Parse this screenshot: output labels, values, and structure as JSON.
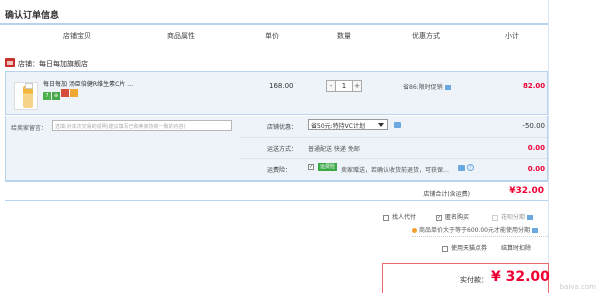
{
  "page": {
    "title": "确认订单信息"
  },
  "columns": [
    "店铺宝贝",
    "商品属性",
    "单价",
    "数量",
    "优惠方式",
    "小计"
  ],
  "shop": {
    "label": "店铺：每日每加旗舰店"
  },
  "item": {
    "name": "每日每加 汤臣倍健R维生素C片 …",
    "price": "168.00",
    "quantity": "1",
    "minus": "-",
    "plus": "+",
    "promo": "省86:限时促销",
    "subtotal": "82.00",
    "badges": [
      "7",
      "⊕",
      "",
      ""
    ]
  },
  "message": {
    "label": "给卖家留言：",
    "placeholder": "选填:对本次交易的说明(建议填写已和卖家协商一致的内容)"
  },
  "options": {
    "discount_label": "店铺优惠：",
    "discount_value": "省50元:特持VC计划",
    "discount_amount": "-50.00",
    "shipping_label": "运送方式：",
    "shipping_value": "普通配送 快递 免邮",
    "shipping_amount": "0.00",
    "insurance_label": "运费险：",
    "insurance_tag": "运费险",
    "insurance_text": "卖家赠送，若确认收货前退货，可获保…",
    "insurance_amount": "0.00"
  },
  "shop_total": {
    "label": "店铺合计(含运费)",
    "value": "¥32.00"
  },
  "payment_options": {
    "proxy": "找人代付",
    "anonymous": "匿名购买",
    "installment": "花呗分期"
  },
  "note": "商品单价大于等于600.00元才能使用分期",
  "points": {
    "label": "使用天猫点券",
    "rules": "结算时扣除"
  },
  "pay": {
    "label": "实付款：",
    "value": "¥ 32.00"
  },
  "watermark": "baiva.com"
}
